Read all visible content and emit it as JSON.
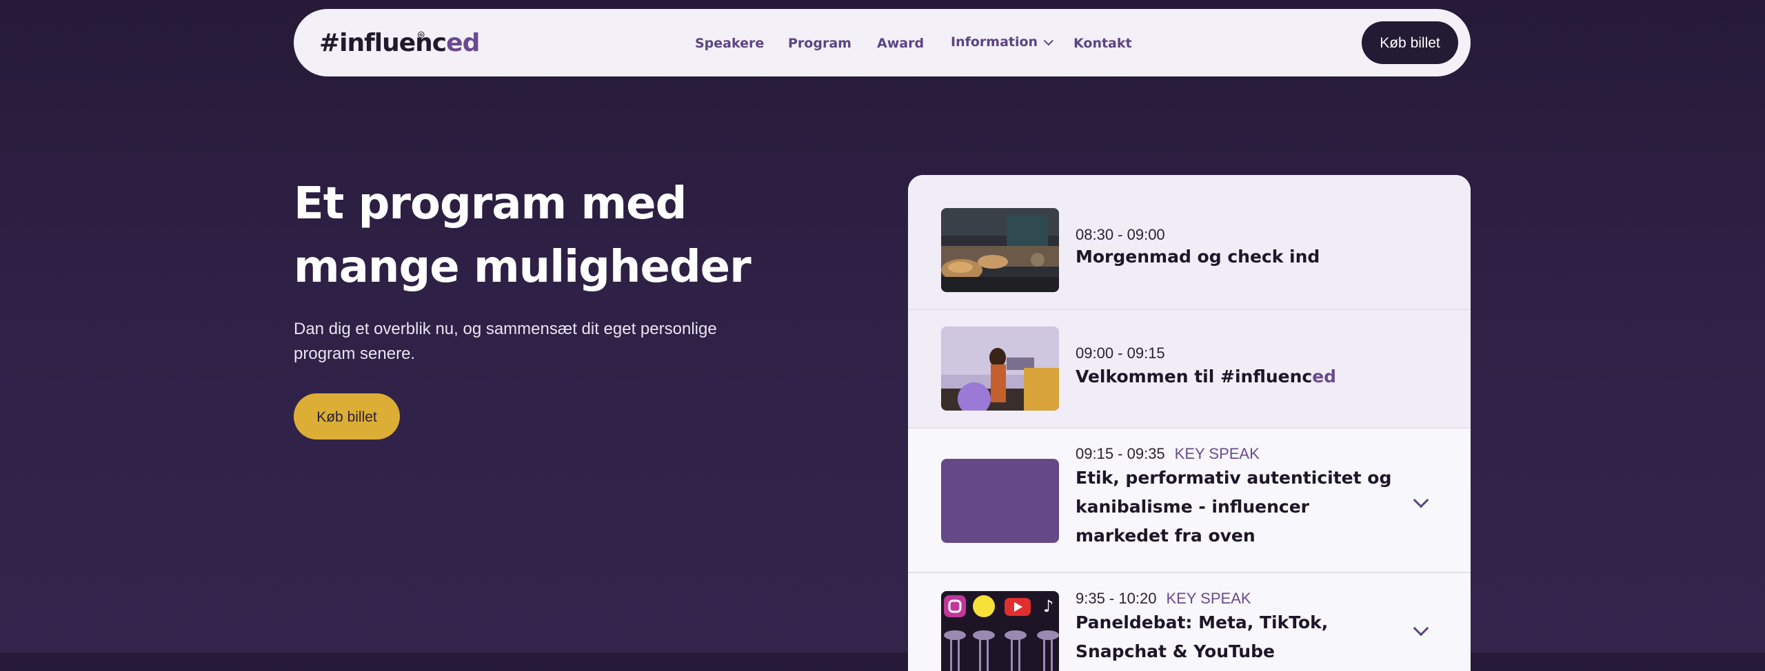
{
  "nav": {
    "logo_main": "#influenc",
    "logo_accent": "ed",
    "items": [
      "Speakere",
      "Program",
      "Award",
      "Information",
      "Kontakt"
    ],
    "cta": "Køb billet"
  },
  "hero": {
    "title_line1": "Et program med",
    "title_line2": "mange muligheder",
    "subtitle": "Dan dig et overblik nu, og sammensæt dit eget personlige program senere.",
    "cta": "Køb billet"
  },
  "program": [
    {
      "time": "08:30 - 09:00",
      "tag": "",
      "title": "Morgenmad og check ind"
    },
    {
      "time": "09:00 - 09:15",
      "tag": "",
      "title_prefix": "Velkommen til ",
      "title_brand": "#influenc",
      "title_brand_accent": "ed"
    },
    {
      "time": "09:15 - 09:35",
      "tag": "KEY SPEAK",
      "title": "Etik, performativ autenticitet og kanibalisme - influencer markedet fra oven"
    },
    {
      "time": "9:35 - 10:20",
      "tag": "KEY SPEAK",
      "title": "Paneldebat: Meta, TikTok, Snapchat & YouTube"
    }
  ],
  "colors": {
    "accent": "#6a4a8f",
    "button_gold": "#dcae35",
    "dark": "#231a33"
  }
}
